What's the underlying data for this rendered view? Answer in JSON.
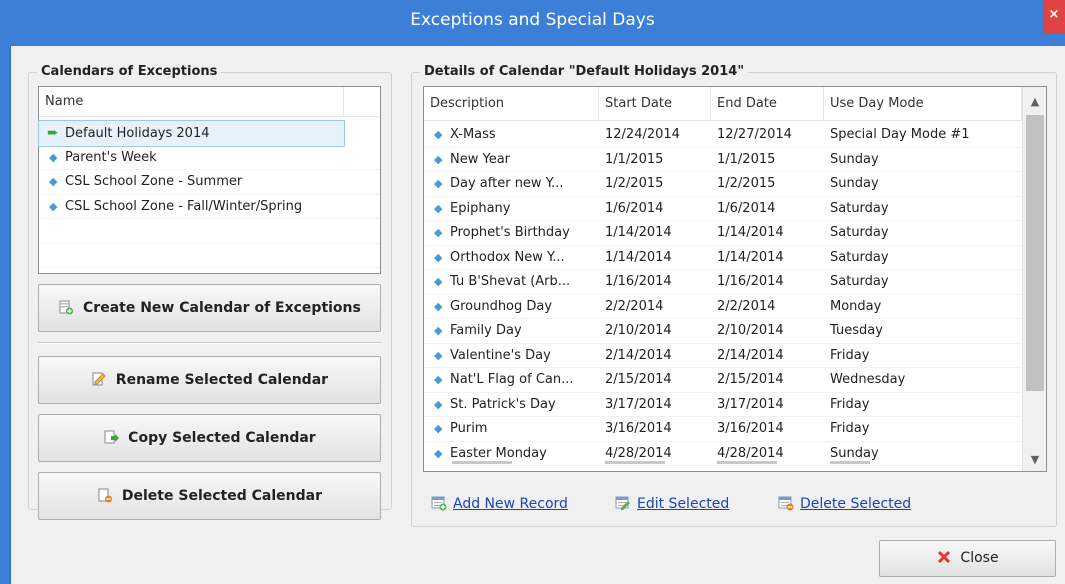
{
  "window": {
    "title": "Exceptions and Special Days",
    "close_glyph": "×"
  },
  "left": {
    "group_title": "Calendars of Exceptions",
    "column_header": "Name",
    "items": [
      {
        "label": "Default Holidays 2014",
        "selected": true
      },
      {
        "label": "Parent's Week"
      },
      {
        "label": "CSL School Zone - Summer"
      },
      {
        "label": "CSL School Zone - Fall/Winter/Spring"
      }
    ],
    "buttons": {
      "create": "Create New Calendar of Exceptions",
      "rename": "Rename Selected Calendar",
      "copy": "Copy Selected Calendar",
      "delete": "Delete Selected Calendar"
    }
  },
  "right": {
    "group_title": "Details of Calendar \"Default Holidays 2014\"",
    "columns": [
      "Description",
      "Start Date",
      "End Date",
      "Use Day Mode"
    ],
    "rows": [
      [
        "X-Mass",
        "12/24/2014",
        "12/27/2014",
        "Special Day Mode #1"
      ],
      [
        "New Year",
        "1/1/2015",
        "1/1/2015",
        "Sunday"
      ],
      [
        "Day after new Y...",
        "1/2/2015",
        "1/2/2015",
        "Sunday"
      ],
      [
        "Epiphany",
        "1/6/2014",
        "1/6/2014",
        "Saturday"
      ],
      [
        "Prophet's Birthday",
        "1/14/2014",
        "1/14/2014",
        "Saturday"
      ],
      [
        "Orthodox New Y...",
        "1/14/2014",
        "1/14/2014",
        "Saturday"
      ],
      [
        "Tu B'Shevat (Arb...",
        "1/16/2014",
        "1/16/2014",
        "Saturday"
      ],
      [
        "Groundhog Day",
        "2/2/2014",
        "2/2/2014",
        "Monday"
      ],
      [
        "Family Day",
        "2/10/2014",
        "2/10/2014",
        "Tuesday"
      ],
      [
        "Valentine's Day",
        "2/14/2014",
        "2/14/2014",
        "Friday"
      ],
      [
        "Nat'L Flag of Can...",
        "2/15/2014",
        "2/15/2014",
        "Wednesday"
      ],
      [
        "St. Patrick's Day",
        "3/17/2014",
        "3/17/2014",
        "Friday"
      ],
      [
        "Purim",
        "3/16/2014",
        "3/16/2014",
        "Friday"
      ],
      [
        "Easter Monday",
        "4/28/2014",
        "4/28/2014",
        "Sunday"
      ]
    ],
    "links": {
      "add": "Add New Record",
      "edit": "Edit Selected",
      "delete": "Delete Selected"
    }
  },
  "footer": {
    "close_label": "Close"
  },
  "icons": {
    "bullet": "diamond-bullet-icon",
    "selected": "green-arrow-icon"
  }
}
